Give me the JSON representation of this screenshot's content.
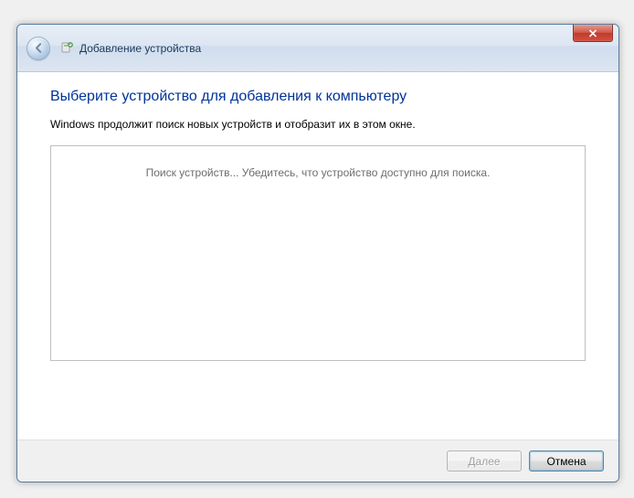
{
  "window": {
    "title": "Добавление устройства"
  },
  "content": {
    "heading": "Выберите устройство для добавления к компьютеру",
    "subtext": "Windows продолжит поиск новых устройств и отобразит их в этом окне.",
    "searching": "Поиск устройств... Убедитесь, что устройство доступно для поиска."
  },
  "buttons": {
    "next": "Далее",
    "cancel": "Отмена"
  }
}
